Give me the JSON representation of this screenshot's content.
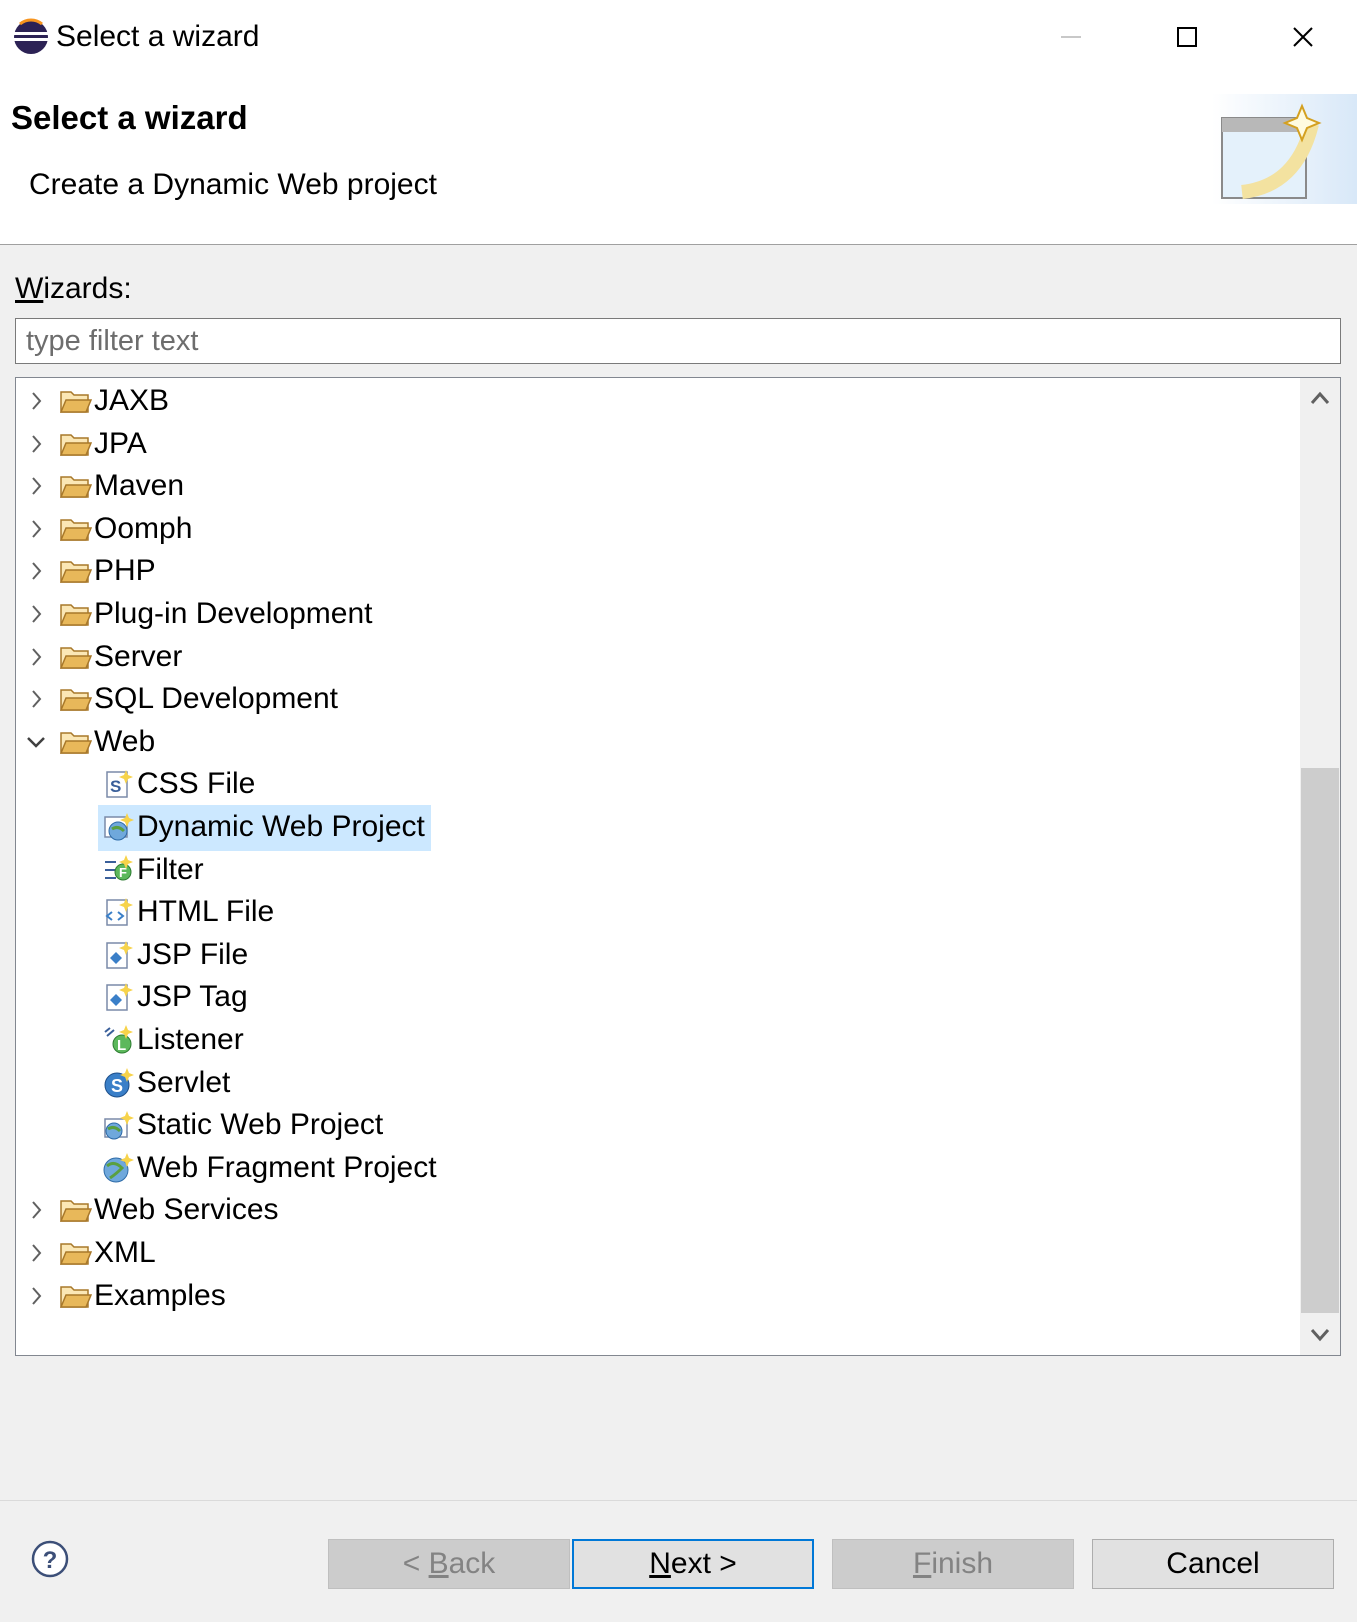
{
  "window": {
    "title": "Select a wizard",
    "icons": {
      "app": "eclipse-icon",
      "minimize": "minimize-icon",
      "maximize": "maximize-icon",
      "close": "close-icon"
    }
  },
  "header": {
    "title": "Select a wizard",
    "description": "Create a Dynamic Web project",
    "banner_icon": "new-wizard-banner-icon"
  },
  "wizards": {
    "label_underlined": "W",
    "label_rest": "izards:",
    "filter_placeholder": "type filter text",
    "filter_value": ""
  },
  "tree": {
    "selected": "Dynamic Web Project",
    "rows": [
      {
        "label": "JAXB",
        "type": "folder",
        "expanded": false
      },
      {
        "label": "JPA",
        "type": "folder",
        "expanded": false
      },
      {
        "label": "Maven",
        "type": "folder",
        "expanded": false
      },
      {
        "label": "Oomph",
        "type": "folder",
        "expanded": false
      },
      {
        "label": "PHP",
        "type": "folder",
        "expanded": false
      },
      {
        "label": "Plug-in Development",
        "type": "folder",
        "expanded": false
      },
      {
        "label": "Server",
        "type": "folder",
        "expanded": false
      },
      {
        "label": "SQL Development",
        "type": "folder",
        "expanded": false
      },
      {
        "label": "Web",
        "type": "folder",
        "expanded": true
      },
      {
        "label": "CSS File",
        "type": "item",
        "icon": "css-file-icon"
      },
      {
        "label": "Dynamic Web Project",
        "type": "item",
        "icon": "dynamic-web-project-icon"
      },
      {
        "label": "Filter",
        "type": "item",
        "icon": "filter-icon"
      },
      {
        "label": "HTML File",
        "type": "item",
        "icon": "html-file-icon"
      },
      {
        "label": "JSP File",
        "type": "item",
        "icon": "jsp-file-icon"
      },
      {
        "label": "JSP Tag",
        "type": "item",
        "icon": "jsp-tag-icon"
      },
      {
        "label": "Listener",
        "type": "item",
        "icon": "listener-icon"
      },
      {
        "label": "Servlet",
        "type": "item",
        "icon": "servlet-icon"
      },
      {
        "label": "Static Web Project",
        "type": "item",
        "icon": "static-web-project-icon"
      },
      {
        "label": "Web Fragment Project",
        "type": "item",
        "icon": "web-fragment-project-icon"
      },
      {
        "label": "Web Services",
        "type": "folder",
        "expanded": false
      },
      {
        "label": "XML",
        "type": "folder",
        "expanded": false
      },
      {
        "label": "Examples",
        "type": "folder",
        "expanded": false
      }
    ]
  },
  "buttons": {
    "back": {
      "prefix": "< ",
      "mnemonic": "B",
      "rest": "ack",
      "enabled": false
    },
    "next": {
      "mnemonic": "N",
      "rest": "ext >",
      "enabled": true
    },
    "finish": {
      "mnemonic": "F",
      "rest": "inish",
      "enabled": false
    },
    "cancel": {
      "label": "Cancel",
      "enabled": true
    },
    "help_icon": "help-icon"
  },
  "colors": {
    "selection": "#cce8ff",
    "folder": "#e8b85a",
    "default_button_border": "#0078d7"
  }
}
